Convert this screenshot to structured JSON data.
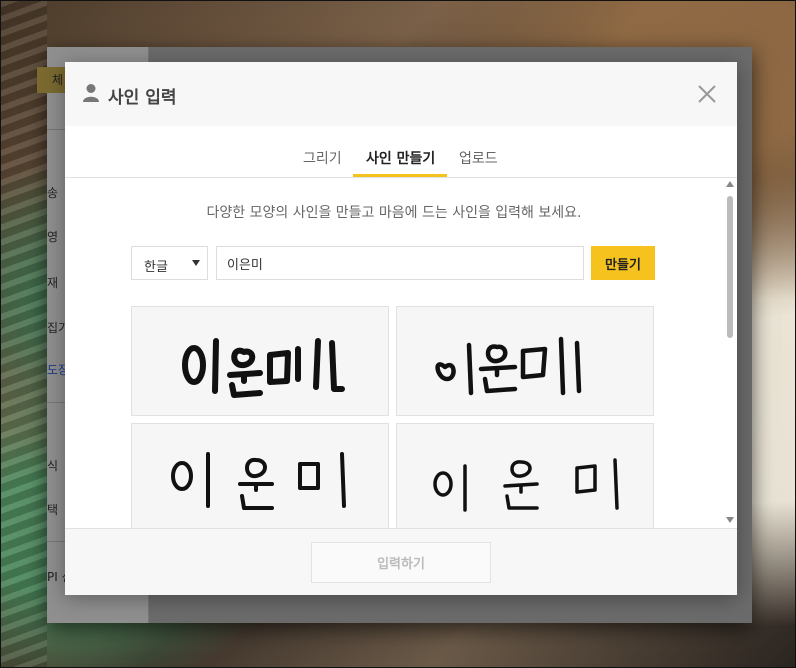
{
  "background_window": {
    "sidebar_items": [
      "체 구",
      "송",
      "영",
      "재",
      "집기",
      "도장",
      "식",
      "택",
      "PI 신"
    ]
  },
  "modal": {
    "title": "사인 입력",
    "close_icon": "close-icon",
    "tabs": [
      {
        "label": "그리기",
        "active": false
      },
      {
        "label": "사인 만들기",
        "active": true
      },
      {
        "label": "업로드",
        "active": false
      }
    ],
    "description": "다양한 모양의 사인을 만들고 마음에 드는 사인을 입력해 보세요.",
    "language_select": {
      "value": "한글",
      "options": [
        "한글"
      ]
    },
    "name_input": {
      "value": "이은미"
    },
    "make_button": "만들기",
    "signatures": [
      "이은미",
      "이은미",
      "이은미",
      "이은미"
    ],
    "submit_button": "입력하기",
    "colors": {
      "accent": "#f6c31e",
      "ink": "#111111",
      "disabled_text": "#bbbbbb"
    }
  }
}
